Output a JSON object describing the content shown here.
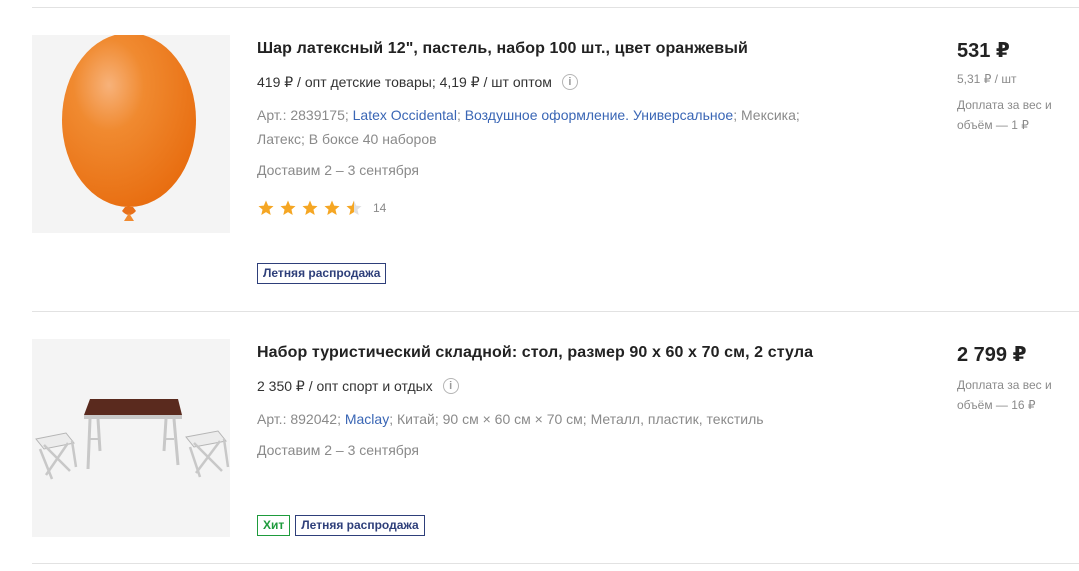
{
  "products": [
    {
      "title": "Шар латексный 12\", пастель, набор 100 шт., цвет оранжевый",
      "wholesale": "419 ₽ / опт детские товары; 4,19 ₽ / шт оптом",
      "art": "Арт.: 2839175;",
      "brand": "Latex Occidental",
      "category": "Воздушное оформление. Универсальное",
      "country": "Мексика;",
      "material": "Латекс;",
      "pack": "В боксе 40 наборов",
      "delivery": "Доставим 2 – 3 сентября",
      "rating": 4.5,
      "rating_count": "14",
      "badges": [
        "Летняя распродажа"
      ],
      "price": "531 ₽",
      "unit_price": "5,31 ₽ / шт",
      "surcharge": "Доплата за вес и объём — 1 ₽",
      "image_color": "#f08a2c"
    },
    {
      "title": "Набор туристический складной: стол, размер 90 х 60 х 70 см, 2 стула",
      "wholesale": "2 350 ₽ / опт спорт и отдых",
      "art": "Арт.: 892042;",
      "brand": "Maclay",
      "country": "Китай;",
      "size": "90 см × 60 см × 70 см;",
      "material": "Металл, пластик, текстиль",
      "delivery": "Доставим 2 – 3 сентября",
      "badges": [
        "Хит",
        "Летняя распродажа"
      ],
      "price": "2 799 ₽",
      "surcharge": "Доплата за вес и объём — 16 ₽"
    }
  ],
  "info_glyph": "i",
  "colors": {
    "link": "#3a66b5",
    "star": "#f5a623",
    "badge_sale": "#2e3f7a",
    "badge_hit": "#1e9b3c"
  }
}
